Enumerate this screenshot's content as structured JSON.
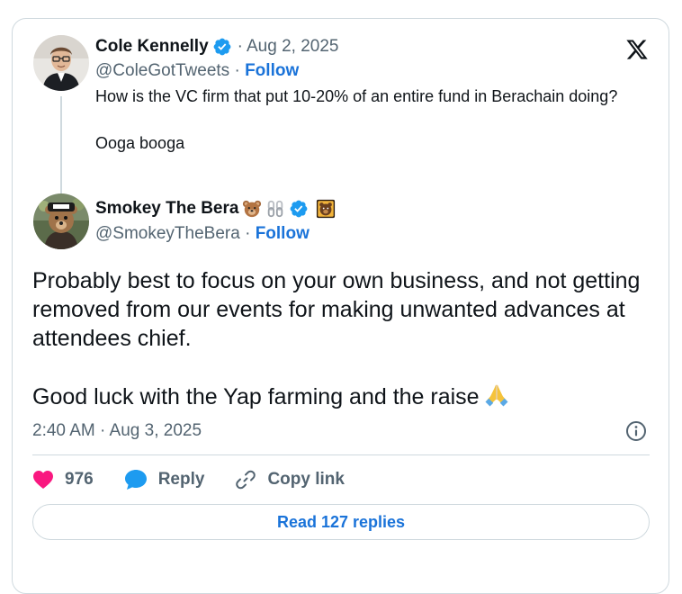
{
  "parent_tweet": {
    "name": "Cole Kennelly",
    "date": "Aug 2, 2025",
    "handle": "@ColeGotTweets",
    "follow_label": "Follow",
    "text_line1": "How is the VC firm that put 10-20% of an entire fund in Berachain doing?",
    "text_line2": "Ooga booga",
    "icons": [
      "verified-badge-icon"
    ]
  },
  "main_tweet": {
    "name": "Smokey The Bera",
    "handle": "@SmokeyTheBera",
    "follow_label": "Follow",
    "text_para1": "Probably best to focus on your own business, and not getting removed from our events for making unwanted advances at attendees chief.",
    "text_para2": "Good luck with the Yap farming and the raise",
    "timestamp": "2:40 AM · Aug 3, 2025",
    "icons": [
      "bear-emoji-icon",
      "chain-link-emoji-icon",
      "verified-badge-icon",
      "affiliate-badge-icon",
      "praying-hands-emoji-icon"
    ]
  },
  "actions": {
    "likes_count": "976",
    "reply_label": "Reply",
    "copy_link_label": "Copy link"
  },
  "read_replies_label": "Read 127 replies",
  "separator": "·",
  "colors": {
    "accent": "#1a73d9",
    "like": "#f91880",
    "muted_text": "#536471",
    "border": "#cfd9de"
  }
}
